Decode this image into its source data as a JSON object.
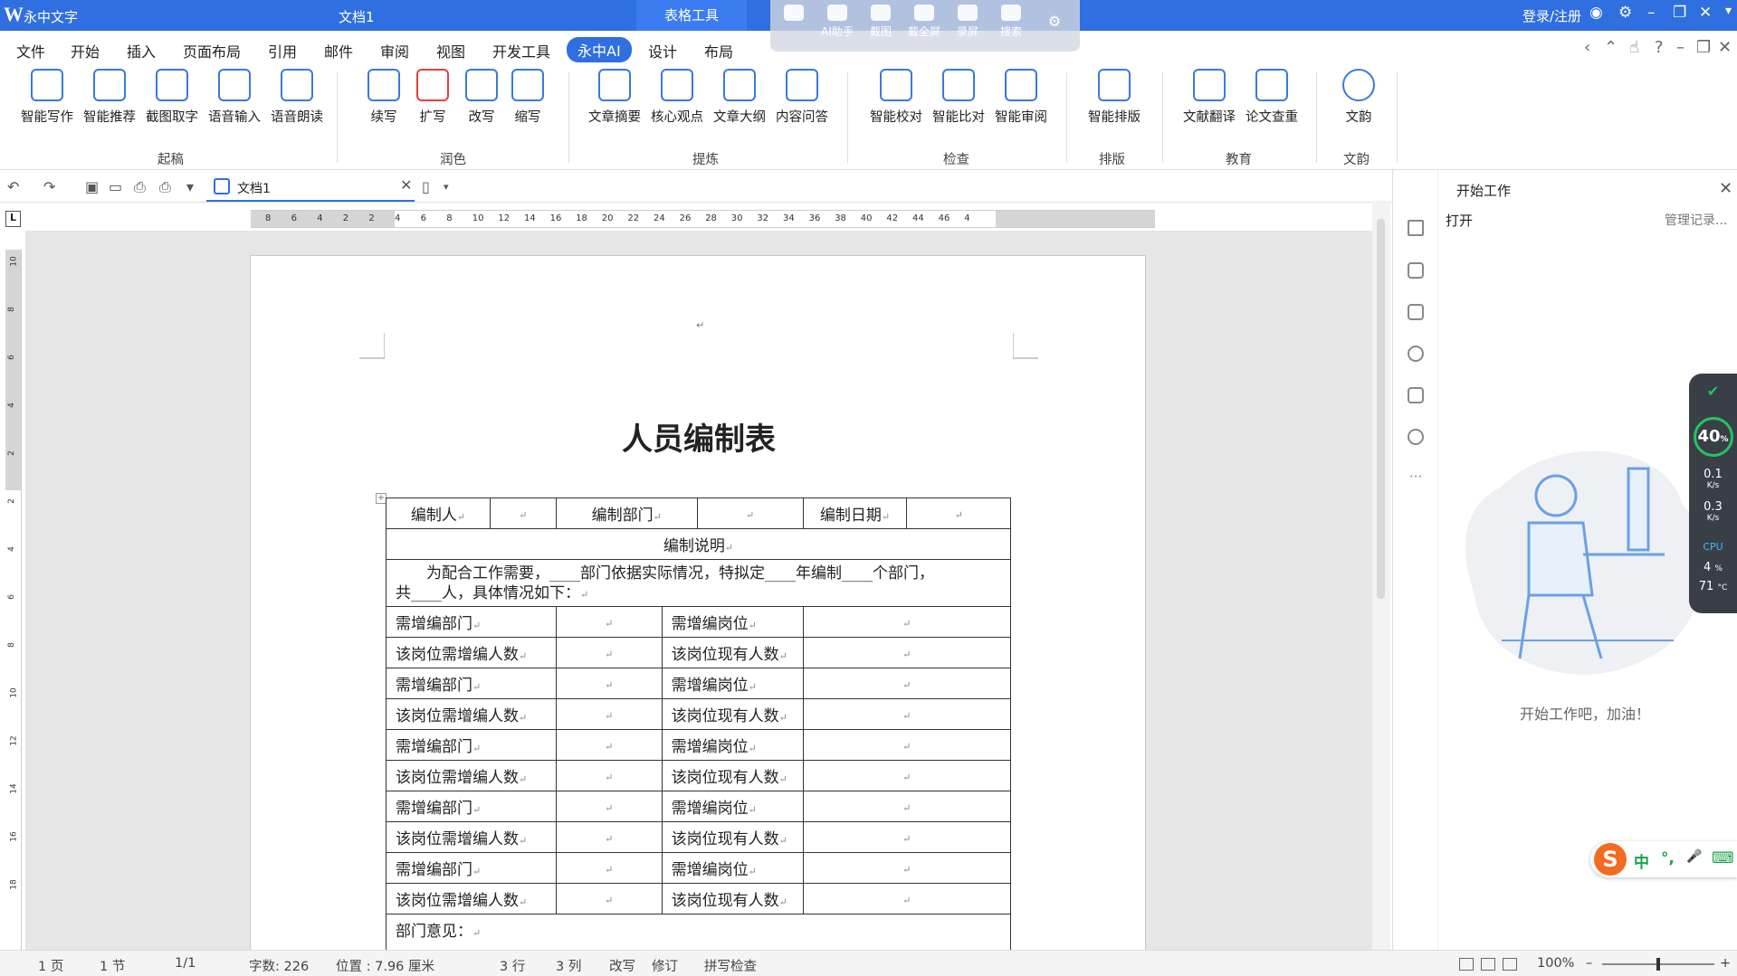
{
  "titlebar": {
    "app_name": "永中文字",
    "doc_name": "文档1",
    "table_tools": "表格工具",
    "login": "登录/注册",
    "float_items": [
      "AI助手",
      "截图",
      "截全屏",
      "录屏",
      "搜索"
    ]
  },
  "menu": {
    "items": [
      "文件",
      "开始",
      "插入",
      "页面布局",
      "引用",
      "邮件",
      "审阅",
      "视图",
      "开发工具",
      "永中AI",
      "设计",
      "布局"
    ],
    "active": "永中AI"
  },
  "ribbon": {
    "buttons": [
      "智能写作",
      "智能推荐",
      "截图取字",
      "语音输入",
      "语音朗读",
      "续写",
      "扩写",
      "改写",
      "缩写",
      "文章摘要",
      "核心观点",
      "文章大纲",
      "内容问答",
      "智能校对",
      "智能比对",
      "智能审阅",
      "智能排版",
      "文献翻译",
      "论文查重",
      "文韵"
    ],
    "groups": [
      "起稿",
      "润色",
      "提炼",
      "检查",
      "排版",
      "教育",
      "文韵"
    ]
  },
  "doc_tab": {
    "label": "文档1"
  },
  "ruler": {
    "h_ticks": [
      "8",
      "6",
      "4",
      "2",
      "2",
      "4",
      "6",
      "8",
      "10",
      "12",
      "14",
      "16",
      "18",
      "20",
      "22",
      "24",
      "26",
      "28",
      "30",
      "32",
      "34",
      "36",
      "38",
      "40",
      "42",
      "44",
      "46",
      "4"
    ],
    "v_ticks": [
      "10",
      "8",
      "6",
      "4",
      "2",
      "2",
      "4",
      "6",
      "8",
      "10",
      "12",
      "14",
      "16",
      "18"
    ]
  },
  "document": {
    "title": "人员编制表",
    "header_row": [
      "编制人",
      "",
      "编制部门",
      "",
      "编制日期",
      ""
    ],
    "section": "编制说明",
    "description_line1": "为配合工作需要，____部门依据实际情况，特拟定____年编制____个部门，",
    "description_line2": "共____人，具体情况如下：",
    "rows": [
      [
        "需增编部门",
        "",
        "需增编岗位",
        ""
      ],
      [
        "该岗位需增编人数",
        "",
        "该岗位现有人数",
        ""
      ],
      [
        "需增编部门",
        "",
        "需增编岗位",
        ""
      ],
      [
        "该岗位需增编人数",
        "",
        "该岗位现有人数",
        ""
      ],
      [
        "需增编部门",
        "",
        "需增编岗位",
        ""
      ],
      [
        "该岗位需增编人数",
        "",
        "该岗位现有人数",
        ""
      ],
      [
        "需增编部门",
        "",
        "需增编岗位",
        ""
      ],
      [
        "该岗位需增编人数",
        "",
        "该岗位现有人数",
        ""
      ],
      [
        "需增编部门",
        "",
        "需增编岗位",
        ""
      ],
      [
        "该岗位需增编人数",
        "",
        "该岗位现有人数",
        ""
      ]
    ],
    "dept_opinion": "部门意见：",
    "para_mark": "↵"
  },
  "panel": {
    "title": "开始工作",
    "open": "打开",
    "manage": "管理记录...",
    "cheer": "开始工作吧，加油！"
  },
  "widget": {
    "percent": "40",
    "percent_unit": "%",
    "up": "0.1",
    "down": "0.3",
    "unit": "K/s",
    "cpu_label": "CPU",
    "cpu": "4",
    "cpu_unit": "%",
    "temp": "71",
    "temp_unit": "°C"
  },
  "ime": {
    "chars": [
      "中",
      "°,",
      "🎤",
      "⌨"
    ]
  },
  "status": {
    "page": "1 页",
    "section": "1 节",
    "pages": "1/1",
    "words": "字数: 226",
    "position": "位置 : 7.96 厘米",
    "line": "3 行",
    "column": "3 列",
    "overwrite": "改写",
    "revise": "修订",
    "spell": "拼写检查",
    "zoom": "100%"
  },
  "colors": {
    "accent": "#2f6fe0",
    "ribbon_icon": "#3a7ad8"
  }
}
